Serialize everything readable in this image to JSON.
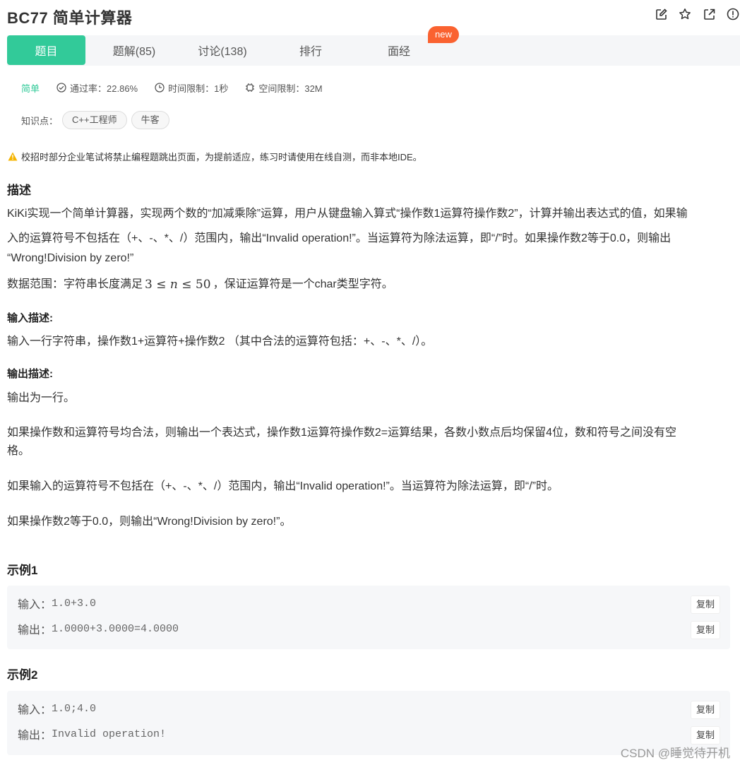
{
  "title": "BC77  简单计算器",
  "tabs": [
    {
      "label": "题目"
    },
    {
      "label": "题解(85)"
    },
    {
      "label": "讨论(138)"
    },
    {
      "label": "排行"
    },
    {
      "label": "面经"
    }
  ],
  "new_badge": "new",
  "meta": {
    "level": "简单",
    "pass_rate": "通过率：22.86%",
    "time_limit": "时间限制：1秒",
    "space_limit": "空间限制：32M"
  },
  "tags": {
    "label": "知识点：",
    "items": [
      "C++工程师",
      "牛客"
    ]
  },
  "warning": "校招时部分企业笔试将禁止编程题跳出页面，为提前适应，练习时请使用在线自测，而非本地IDE。",
  "description": {
    "heading": "描述",
    "line1": "KiKi实现一个简单计算器，实现两个数的“加减乘除”运算，用户从键盘输入算式“操作数1运算符操作数2”，计算并输出表达式的值，如果输",
    "line2": "入的运算符号不包括在（+、-、*、/）范围内，输出“Invalid operation!”。当运算符为除法运算，即“/”时。如果操作数2等于0.0，则输出",
    "line3": "“Wrong!Division by zero!”",
    "range_prefix": "数据范围：字符串长度满足",
    "range_math_a": "3",
    "range_math_le1": "≤",
    "range_math_n": "n",
    "range_math_le2": "≤",
    "range_math_b": "50",
    "range_suffix": "，保证运算符是一个char类型字符。"
  },
  "input_desc": {
    "heading": "输入描述:",
    "text": "输入一行字符串，操作数1+运算符+操作数2 （其中合法的运算符包括：+、-、*、/）。"
  },
  "output_desc": {
    "heading": "输出描述:",
    "p1": "输出为一行。",
    "p2a": "如果操作数和运算符号均合法，则输出一个表达式，操作数1运算符操作数2=运算结果，各数小数点后均保留4位，数和符号之间没有空",
    "p2b": "格。",
    "p3": "如果输入的运算符号不包括在（+、-、*、/）范围内，输出“Invalid operation!”。当运算符为除法运算，即“/”时。",
    "p4": "如果操作数2等于0.0，则输出“Wrong!Division by zero!”。"
  },
  "examples": [
    {
      "heading": "示例1",
      "input_label": "输入：",
      "input": "1.0+3.0",
      "output_label": "输出：",
      "output": "1.0000+3.0000=4.0000",
      "copy": "复制"
    },
    {
      "heading": "示例2",
      "input_label": "输入：",
      "input": "1.0;4.0",
      "output_label": "输出：",
      "output": "Invalid operation!",
      "copy": "复制"
    }
  ],
  "watermark": "CSDN @睡觉待开机",
  "colors": {
    "accent": "#32ca99",
    "badge": "#fa6230",
    "warning": "#f5b400"
  }
}
